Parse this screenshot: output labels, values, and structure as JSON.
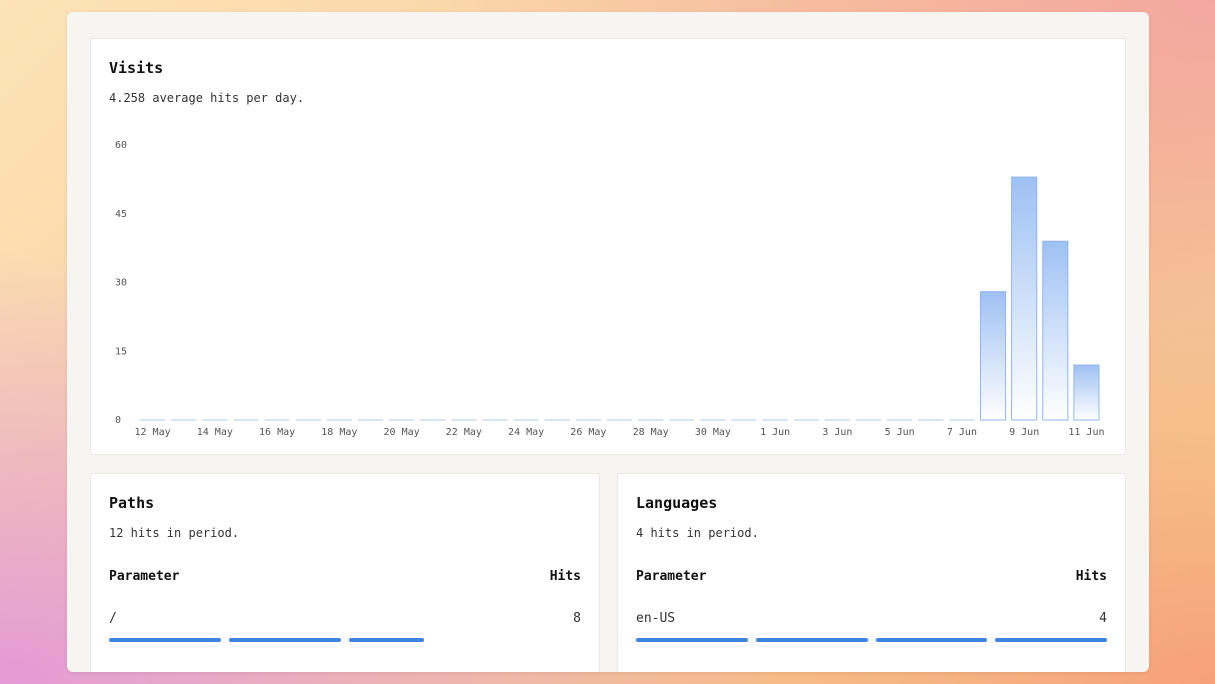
{
  "visits": {
    "title": "Visits",
    "subtitle": "4.258 average hits per day."
  },
  "paths": {
    "title": "Paths",
    "subtitle": "12 hits in period.",
    "col_param": "Parameter",
    "col_hits": "Hits",
    "rows": [
      {
        "param": "/",
        "hits": "8",
        "fraction": 0.6667
      }
    ]
  },
  "languages": {
    "title": "Languages",
    "subtitle": "4 hits in period.",
    "col_param": "Parameter",
    "col_hits": "Hits",
    "rows": [
      {
        "param": "en-US",
        "hits": "4",
        "fraction": 1.0
      }
    ]
  },
  "colors": {
    "bar_stroke": "#8fb5ee",
    "bar_fill_top": "#9ec0f3",
    "bar_fill_bottom": "#ffffff",
    "accent": "#3f84e5"
  },
  "chart_data": {
    "type": "bar",
    "title": "Visits",
    "ylim": [
      0,
      60
    ],
    "yticks": [
      "0",
      "15",
      "30",
      "45",
      "60"
    ],
    "x_tick_labels": [
      "12 May",
      "14 May",
      "16 May",
      "18 May",
      "20 May",
      "22 May",
      "24 May",
      "26 May",
      "28 May",
      "30 May",
      "1 Jun",
      "3 Jun",
      "5 Jun",
      "7 Jun",
      "9 Jun",
      "11 Jun"
    ],
    "categories": [
      "12 May",
      "13 May",
      "14 May",
      "15 May",
      "16 May",
      "17 May",
      "18 May",
      "19 May",
      "20 May",
      "21 May",
      "22 May",
      "23 May",
      "24 May",
      "25 May",
      "26 May",
      "27 May",
      "28 May",
      "29 May",
      "30 May",
      "31 May",
      "1 Jun",
      "2 Jun",
      "3 Jun",
      "4 Jun",
      "5 Jun",
      "6 Jun",
      "7 Jun",
      "8 Jun",
      "9 Jun",
      "10 Jun",
      "11 Jun"
    ],
    "values": [
      0,
      0,
      0,
      0,
      0,
      0,
      0,
      0,
      0,
      0,
      0,
      0,
      0,
      0,
      0,
      0,
      0,
      0,
      0,
      0,
      0,
      0,
      0,
      0,
      0,
      0,
      0,
      28,
      53,
      39,
      12
    ],
    "grid": false
  }
}
